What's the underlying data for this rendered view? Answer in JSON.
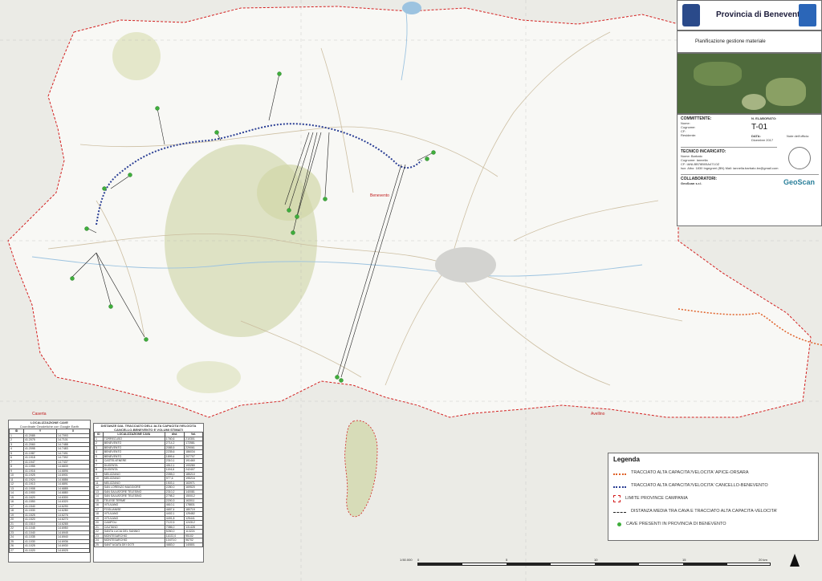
{
  "header": {
    "province": "Provincia di Benevento",
    "subtitle": "Pianificazione gestione materiale"
  },
  "info": {
    "committente_title": "COMMITTENTE:",
    "committente_fields": [
      "Nome:",
      "Cognome:",
      "CF:",
      "Residente:"
    ],
    "elaborato_title": "N. ELABORATO:",
    "elaborato": "T-01",
    "data_title": "DATA:",
    "data": "Dicembre 2017",
    "note_title": "Note dell'ufficio:",
    "tecnico_title": "TECNICO INCARICATO:",
    "tecnico_lines": [
      "Nome: Barbato",
      "Cognome: Iannella",
      "CF: IANLBB78B05A471OZ",
      "Iscr. Albo: 1830 Ingegneri (BN) Mail: iannella.barbato.bn@gmail.com"
    ],
    "collaboratori_title": "COLLABORATORI:",
    "collaboratori_name": "GeoScan s.r.l.",
    "logo": "GeoScan"
  },
  "legend": {
    "title": "Legenda",
    "items": [
      {
        "symbol": "orange-dotted",
        "label": "TRACCIATO ALTA CAPACITA'/VELOCITA' APICE-ORSARA"
      },
      {
        "symbol": "blue-dotted",
        "label": "TRACCIATO ALTA CAPACITA'/VELOCITA' CANCELLO-BENEVENTO"
      },
      {
        "symbol": "red-dashed-box",
        "label": "LIMITE PROVINCE CAMPANIA"
      },
      {
        "symbol": "black-dashed",
        "label": "DISTANZA MEDIA TRA CAVA E TRACCIATO ALTA CAPACITA-VELOCITA'"
      },
      {
        "symbol": "green-dot",
        "label": "CAVE PRESENTI IN PROVINCIA DI BENEVENTO"
      }
    ]
  },
  "map_labels": {
    "benevento": "Benevento",
    "caserta": "Caserta",
    "avellino": "Avellino"
  },
  "table1": {
    "title": "LOCALIZZAZIONE CAVE",
    "subtitle": "Coordinate Geodetiche con Google Earth",
    "headers": [
      "ID",
      "Y",
      "X"
    ],
    "rows": [
      [
        "1",
        "41.2085",
        "14.7093"
      ],
      [
        "2",
        "41.2075",
        "14.7101"
      ],
      [
        "3",
        "41.2060",
        "14.7488"
      ],
      [
        "4",
        "41.2095",
        "14.7483"
      ],
      [
        "5",
        "41.1987",
        "14.7491"
      ],
      [
        "6",
        "41.1918",
        "14.7392"
      ],
      [
        "7",
        "41.1947",
        "14.7437"
      ],
      [
        "8",
        "41.1955",
        "14.6839"
      ],
      [
        "9",
        "41.1916",
        "14.6896"
      ],
      [
        "10",
        "41.1925",
        "14.6901"
      ],
      [
        "11",
        "41.1924",
        "14.6886"
      ],
      [
        "12",
        "41.1913",
        "14.6891"
      ],
      [
        "13",
        "41.1908",
        "14.6885"
      ],
      [
        "14",
        "41.1900",
        "14.6880"
      ],
      [
        "15",
        "41.1620",
        "14.6300"
      ],
      [
        "16",
        "41.1550",
        "14.6320"
      ],
      [
        "17",
        "41.1540",
        "14.6290"
      ],
      [
        "18",
        "41.1530",
        "14.6280"
      ],
      [
        "19",
        "41.1525",
        "14.6276"
      ],
      [
        "20",
        "41.1520",
        "14.6270"
      ],
      [
        "21",
        "41.1510",
        "14.6265"
      ],
      [
        "22",
        "41.1045",
        "14.6950"
      ],
      [
        "23",
        "41.1040",
        "14.6945"
      ],
      [
        "24",
        "41.1035",
        "14.6940"
      ],
      [
        "25",
        "41.1030",
        "14.6936"
      ],
      [
        "26",
        "41.1025",
        "14.6930"
      ],
      [
        "27",
        "41.1020",
        "14.6925"
      ]
    ]
  },
  "table2": {
    "title": "DISTANZE DAL TRACCIATO DELL'ALTA CAPACITA'/VELOCITA CANCELLO-BENEVENTO E VOLUMI STIMATI",
    "headers": [
      "ID",
      "LOCALIZZAZIONE CAVA",
      "dist.",
      "Vol."
    ],
    "rows": [
      [
        "1",
        "TORRECUSO",
        "1760,6",
        "210301"
      ],
      [
        "2",
        "BENEVENTO",
        "2714,2",
        "172581"
      ],
      [
        "3",
        "BENEVENTO",
        "2085,5",
        "229061"
      ],
      [
        "4",
        "BENEVENTO",
        "2235,6",
        "186034"
      ],
      [
        "5",
        "BENEVENTO",
        "1899,4",
        "207707"
      ],
      [
        "6",
        "CASTELVENERE",
        "2310,1",
        "191460"
      ],
      [
        "7",
        "DUGENTA",
        "4512,1",
        "193280"
      ],
      [
        "8",
        "DUGENTA",
        "1194,6",
        "242407"
      ],
      [
        "9",
        "MELIZZANO",
        "2055,0",
        "185210"
      ],
      [
        "10",
        "MELIZZANO",
        "977,6",
        "195216"
      ],
      [
        "11",
        "MELIZZANO",
        "1503,1",
        "163971"
      ],
      [
        "12",
        "SAN LORENZO MAGGIORE",
        "2280,0",
        "169520"
      ],
      [
        "13",
        "SAN SALVATORE TELESINO",
        "2310,2",
        "140081"
      ],
      [
        "14",
        "SAN SALVATORE TELESINO",
        "2798,2",
        "150012"
      ],
      [
        "15",
        "TELESE TERME",
        "2200,3",
        "163011"
      ],
      [
        "16",
        "VITULANO",
        "4610,1",
        "178831"
      ],
      [
        "17",
        "FOGLIANISE",
        "4657,4",
        "180719"
      ],
      [
        "18",
        "VITULANO",
        "4402,1",
        "125482"
      ],
      [
        "19",
        "VITULANO",
        "4491,8",
        "125441"
      ],
      [
        "20",
        "CAMPOLI",
        "7122,5",
        "124312"
      ],
      [
        "21",
        "CAUTANO",
        "7086,0",
        "131428"
      ],
      [
        "22",
        "SANTA LUCIA DEL SANNIO",
        "5260,0",
        "113224"
      ],
      [
        "23",
        "MONTESARCHIO",
        "11022,0",
        "95102"
      ],
      [
        "24",
        "MONTESARCHIO",
        "10470,0",
        "96702"
      ],
      [
        "25",
        "SANT'AGATA DEI GOTI",
        "4683,0",
        "140801"
      ]
    ]
  },
  "scale": {
    "ratio": "1:50.000",
    "labels": [
      "0",
      "5",
      "10",
      "15",
      "20 km"
    ]
  },
  "colors": {
    "hsr_apice_orsara": "#e0622a",
    "hsr_cancello_benevento": "#2b3f95",
    "province_limit": "#d42020",
    "quarry": "#3fae3c"
  }
}
